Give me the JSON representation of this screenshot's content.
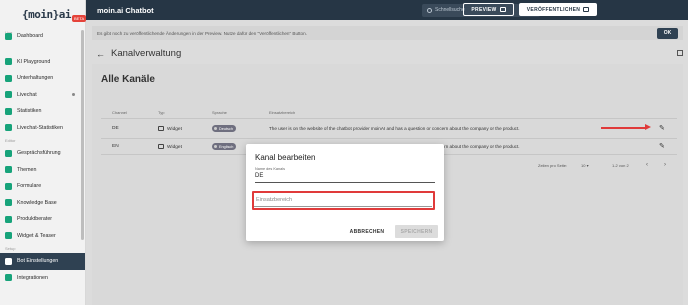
{
  "app": {
    "logo": "{moin}ai",
    "logo_badge": "BETA",
    "title": "moin.ai Chatbot"
  },
  "topbar": {
    "search_placeholder": "Schnellsuche",
    "preview_label": "PREVIEW",
    "publish_label": "VERÖFFENTLICHEN"
  },
  "sidebar": {
    "sections": [
      "Live",
      "Editor",
      "Setup"
    ],
    "items": [
      {
        "label": "Dashboard",
        "icon": "dashboard-icon"
      },
      {
        "label": "KI Playground",
        "icon": "graduation-cap-icon"
      },
      {
        "label": "Unterhaltungen",
        "icon": "chat-icon"
      },
      {
        "label": "Livechat",
        "icon": "livechat-icon"
      },
      {
        "label": "Statistiken",
        "icon": "chart-icon"
      },
      {
        "label": "Livechat-Statistiken",
        "icon": "chart-icon"
      },
      {
        "label": "Gesprächsführung",
        "icon": "flow-icon"
      },
      {
        "label": "Themen",
        "icon": "folder-icon"
      },
      {
        "label": "Formulare",
        "icon": "form-icon"
      },
      {
        "label": "Knowledge Base",
        "icon": "book-icon"
      },
      {
        "label": "Produktberater",
        "icon": "product-icon"
      },
      {
        "label": "Widget & Teaser",
        "icon": "widget-icon"
      },
      {
        "label": "Bot Einstellungen",
        "icon": "settings-icon"
      },
      {
        "label": "Integrationen",
        "icon": "integration-icon"
      }
    ]
  },
  "notice": {
    "text": "Es gibt noch zu veröffentlichende Änderungen in der Preview. Nutze dafür den \"Veröffentlichen\" Button.",
    "ok_label": "OK"
  },
  "page": {
    "title": "Kanalverwaltung",
    "card_title": "Alle Kanäle"
  },
  "table": {
    "headers": [
      "Channel",
      "Typ",
      "Sprache",
      "Einsatzbereich"
    ],
    "rows": [
      {
        "channel": "DE",
        "type": "Widget",
        "language": "Deutsch",
        "scope": "The user is on the website of the chatbot provider moinAI and has a question or concern about the company or the product."
      },
      {
        "channel": "EN",
        "type": "Widget",
        "language": "Englisch",
        "scope": "The user is on the website of the chatbot provider moinAI and has a question or concern about the company or the product."
      }
    ],
    "pagination": {
      "rows_label": "Zeilen pro Seite:",
      "rows_value": "10",
      "range": "1-2 von 2"
    }
  },
  "modal": {
    "title": "Kanal bearbeiten",
    "name_label": "Name des Kanals",
    "name_value": "DE",
    "scope_placeholder": "Einsatzbereich",
    "cancel_label": "ABBRECHEN",
    "save_label": "SPEICHERN"
  },
  "colors": {
    "topbar": "#263645",
    "accent_green": "#17a37a",
    "highlight_red": "#e03a3a"
  }
}
